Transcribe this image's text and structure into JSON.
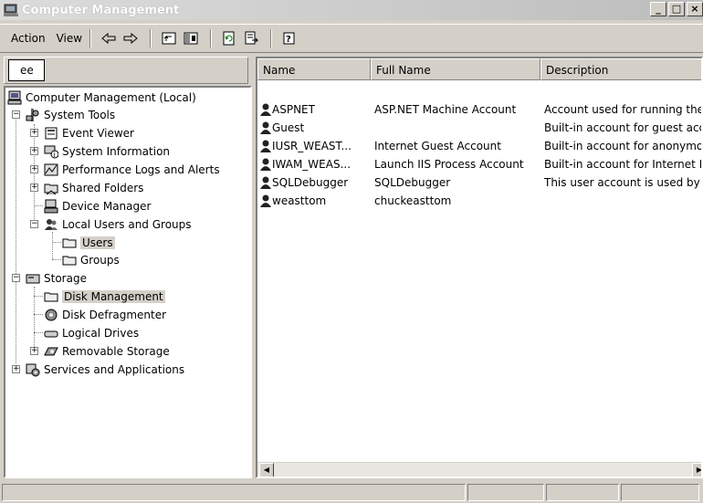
{
  "window": {
    "title": "Computer Management",
    "icon": "computer-management-icon",
    "controls": [
      "_",
      "□",
      "×"
    ]
  },
  "menu": {
    "action": "Action",
    "view": "View"
  },
  "toolbar": {
    "icons": [
      "back-arrow-icon",
      "forward-arrow-icon",
      "up-folder-icon",
      "show-hide-tree-icon",
      "refresh-icon",
      "export-list-icon",
      "help-icon"
    ]
  },
  "tree_tab": {
    "label": "ee"
  },
  "tree": {
    "root": "Computer Management (Local)",
    "system_tools": "System Tools",
    "event_viewer": "Event Viewer",
    "system_information": "System Information",
    "performance_logs": "Performance Logs and Alerts",
    "shared_folders": "Shared Folders",
    "device_manager": "Device Manager",
    "local_users": "Local Users and Groups",
    "users": "Users",
    "groups": "Groups",
    "storage": "Storage",
    "disk_management": "Disk Management",
    "disk_defragmenter": "Disk Defragmenter",
    "logical_drives": "Logical Drives",
    "removable_storage": "Removable Storage",
    "services_apps": "Services and Applications"
  },
  "list": {
    "columns": [
      "Name",
      "Full Name",
      "Description"
    ],
    "rows": [
      {
        "name": "ASPNET",
        "full_name": "ASP.NET Machine Account",
        "description": "Account used for running the"
      },
      {
        "name": "Guest",
        "full_name": "",
        "description": "Built-in account for guest acc"
      },
      {
        "name": "IUSR_WEAST...",
        "full_name": "Internet Guest Account",
        "description": "Built-in account for anonymo"
      },
      {
        "name": "IWAM_WEAS...",
        "full_name": "Launch IIS Process Account",
        "description": "Built-in account for Internet I"
      },
      {
        "name": "SQLDebugger",
        "full_name": "SQLDebugger",
        "description": "This user account is used by"
      },
      {
        "name": "weasttom",
        "full_name": "chuckeasttom",
        "description": ""
      }
    ]
  },
  "colors": {
    "window_bg": "#d4d0c8",
    "pane_bg": "#ffffff",
    "selection": "#d4d0c8"
  }
}
